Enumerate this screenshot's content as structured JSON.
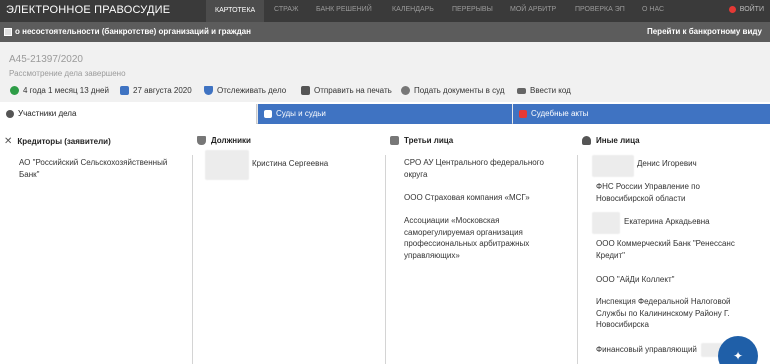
{
  "nav": {
    "brand": "ЭЛЕКТРОННОЕ ПРАВОСУДИЕ",
    "items": [
      "КАРТОТЕКА",
      "СТРАЖ",
      "БАНК РЕШЕНИЙ",
      "КАЛЕНДАРЬ",
      "ПЕРЕРЫВЫ",
      "МОЙ АРБИТР",
      "ПРОВЕРКА ЭП",
      "О НАС"
    ],
    "login": "ВОЙТИ"
  },
  "subheader": {
    "title": "о несостоятельности (банкротстве) организаций и граждан",
    "link": "Перейти к банкротному виду"
  },
  "case": {
    "number": "А45-21397/2020",
    "status": "Рассмотрение дела завершено",
    "duration": "4 года 1 месяц 13 дней",
    "date": "27 августа 2020",
    "actions": {
      "track": "Отслеживать дело",
      "print": "Отправить на печать",
      "submit": "Подать документы в суд",
      "code": "Ввести код"
    }
  },
  "tabs": [
    "Участники дела",
    "Суды и судьи",
    "Судебные акты"
  ],
  "columns": {
    "creditors": {
      "title": "Кредиторы (заявители)",
      "items": [
        "АО \"Российский Сельскохозяйственный Банк\""
      ]
    },
    "debtors": {
      "title": "Должники",
      "items": [
        "Кристина Сергеевна"
      ]
    },
    "third": {
      "title": "Третьи лица",
      "items": [
        "СРО АУ Центрального федерального округа",
        "ООО Страховая компания «МСГ»",
        "Ассоциации «Московская саморегулируемая организация профессиональных арбитражных управляющих»"
      ]
    },
    "other": {
      "title": "Иные лица",
      "items": [
        "Денис Игоревич",
        "ФНС России Управление по Новосибирской области",
        "Екатерина Аркадьевна",
        "ООО Коммерческий Банк \"Ренессанс Кредит\"",
        "ООО \"АйДи Коллект\"",
        "Инспекция Федеральной Налоговой Службы по Калининскому Району Г. Новосибирска",
        "Финансовый управляющий"
      ]
    }
  }
}
